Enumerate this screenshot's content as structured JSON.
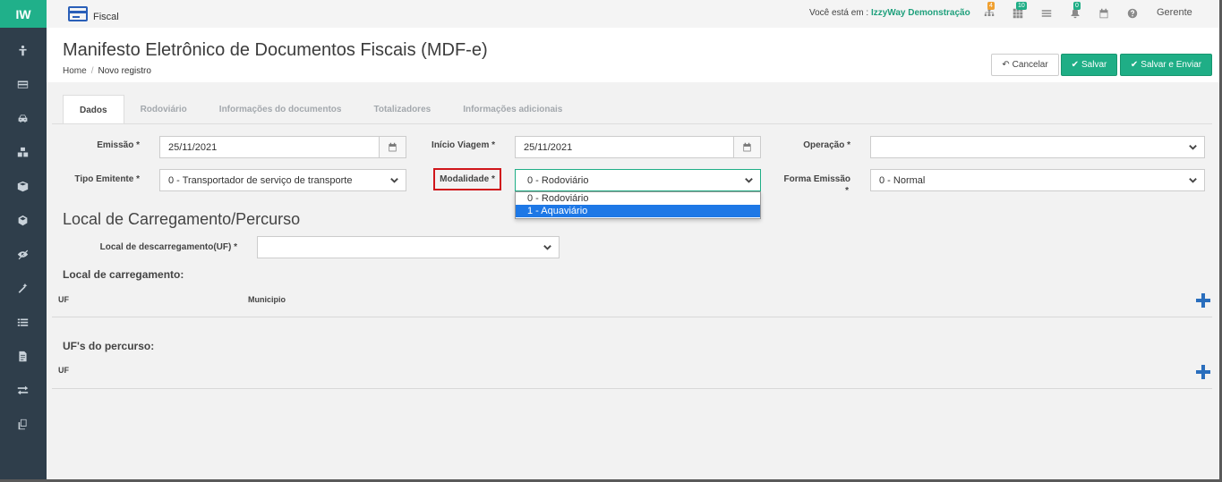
{
  "app": {
    "logo": "IW",
    "module": "Fiscal"
  },
  "topbar": {
    "company_prefix": "Você está em :",
    "company_name": "IzzyWay Demonstração",
    "badges": [
      {
        "icon": "org-chart-icon",
        "count": "4",
        "color": "#f0a030"
      },
      {
        "icon": "grid-icon",
        "count": "10",
        "color": "#1fae86"
      },
      {
        "icon": "list-icon",
        "count": "",
        "color": ""
      },
      {
        "icon": "bell-icon",
        "count": "0",
        "color": "#1fae86"
      },
      {
        "icon": "calendar-icon",
        "count": "",
        "color": ""
      },
      {
        "icon": "help-icon",
        "count": "",
        "color": ""
      }
    ],
    "user": "Gerente"
  },
  "header": {
    "title": "Manifesto Eletrônico de Documentos Fiscais (MDF-e)",
    "breadcrumb_home": "Home",
    "breadcrumb_sep": "/",
    "breadcrumb_current": "Novo registro",
    "cancel_label": "Cancelar",
    "save_label": "Salvar",
    "save_send_label": "Salvar e Enviar"
  },
  "tabs": [
    "Dados",
    "Rodoviário",
    "Informações do documentos",
    "Totalizadores",
    "Informações adicionais"
  ],
  "form": {
    "emissao_label": "Emissão *",
    "emissao_value": "25/11/2021",
    "inicio_label": "Início Viagem *",
    "inicio_value": "25/11/2021",
    "operacao_label": "Operação *",
    "operacao_value": "",
    "tipo_emitente_label": "Tipo Emitente *",
    "tipo_emitente_value": "0 - Transportador de serviço de transporte",
    "modalidade_label": "Modalidade *",
    "modalidade_value": "0 - Rodoviário",
    "modalidade_options": [
      "0 - Rodoviário",
      "1 - Aquaviário"
    ],
    "forma_emissao_label": "Forma Emissão",
    "forma_emissao_star": "*",
    "forma_emissao_value": "0 - Normal"
  },
  "local": {
    "section_title": "Local de Carregamento/Percurso",
    "descarregamento_label": "Local de descarregamento(UF) *",
    "descarregamento_value": "",
    "carregamento_title": "Local de carregamento:",
    "col_uf": "UF",
    "col_municipio": "Municipio",
    "percurso_title": "UF's do percurso:",
    "percurso_col_uf": "UF"
  }
}
